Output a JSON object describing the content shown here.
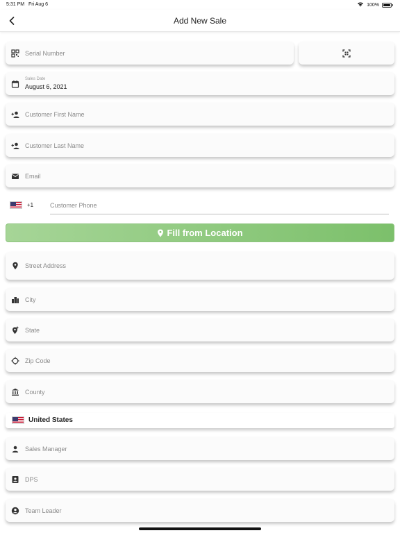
{
  "status_bar": {
    "time": "5:31 PM",
    "date": "Fri Aug 6",
    "battery": "100%"
  },
  "nav": {
    "title": "Add New Sale"
  },
  "form": {
    "serial_number": {
      "placeholder": "Serial Number"
    },
    "sales_date": {
      "label": "Sales Date",
      "value": "August 6, 2021"
    },
    "customer_first_name": {
      "placeholder": "Customer First Name"
    },
    "customer_last_name": {
      "placeholder": "Customer Last Name"
    },
    "email": {
      "placeholder": "Email"
    },
    "phone": {
      "country_code": "+1",
      "placeholder": "Customer Phone"
    },
    "fill_from_location": {
      "label": "Fill from Location"
    },
    "street_address": {
      "placeholder": "Street Address"
    },
    "city": {
      "placeholder": "City"
    },
    "state": {
      "placeholder": "State"
    },
    "zip_code": {
      "placeholder": "Zip Code"
    },
    "county": {
      "placeholder": "County"
    },
    "country": {
      "value": "United States"
    },
    "sales_manager": {
      "placeholder": "Sales Manager"
    },
    "dps": {
      "placeholder": "DPS"
    },
    "team_leader": {
      "placeholder": "Team Leader"
    }
  },
  "colors": {
    "fill_button_start": "#a6d597",
    "fill_button_end": "#7cc06b"
  }
}
